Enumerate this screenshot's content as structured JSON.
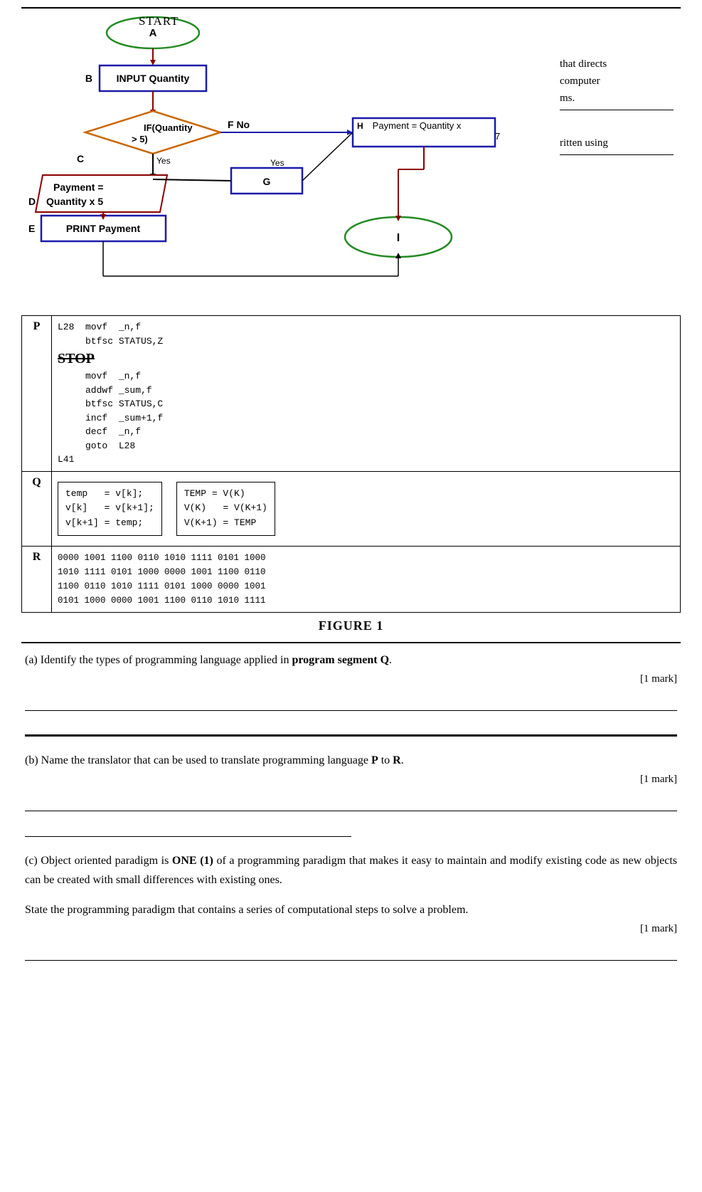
{
  "figure": {
    "title": "FIGURE 1",
    "right_text_line1": "that directs",
    "right_text_line2": "computer",
    "right_text_line3": "ms.",
    "right_text_line4": "ritten using",
    "start_label": "START",
    "flowchart": {
      "node_a_label": "A",
      "node_a_text": "INPUT Quantity",
      "node_b_label": "B",
      "node_if_text": "IF(Quantity > 5)",
      "f_label": "F No",
      "h_label": "H",
      "h_text": "Payment = Quantity x",
      "h_num": "7",
      "yes_label_1": "Yes",
      "yes_label_2": "Yes",
      "c_label": "C",
      "yes_arrow_label": "Yes",
      "g_label": "G",
      "payment_text": "Payment =",
      "quantity_text": "Quantity x 5",
      "print_text": "PRINT Payment",
      "i_label": "I"
    }
  },
  "segments": {
    "p": {
      "label": "P",
      "code_lines": [
        "L28  movf  _n,f",
        "     btfsc STATUS,Z",
        "     movf  _n,f",
        "     addwf _sum,f",
        "     btfsc STATUS,C",
        "     incf  _sum+1,f",
        "     decf  _n,f",
        "     goto  L28",
        "L41"
      ],
      "stop_text": "STOP"
    },
    "q": {
      "label": "Q",
      "box1_lines": [
        "temp   = v[k];",
        "v[k]   = v[k+1];",
        "v[k+1] = temp;"
      ],
      "box2_lines": [
        "TEMP = V(K)",
        "V(K)   = V(K+1)",
        "V(K+1) = TEMP"
      ]
    },
    "r": {
      "label": "R",
      "lines": [
        "0000 1001 1100 0110 1010 1111 0101 1000",
        "1010 1111 0101 1000 0000 1001 1100 0110",
        "1100 0110 1010 1111 0101 1000 0000 1001",
        "0101 1000 0000 1001 1100 0110 1010 1111"
      ]
    }
  },
  "questions": {
    "a": {
      "prefix": "(a)",
      "text": "Identify the types of programming language applied in",
      "bold_part": "program segment Q",
      "suffix": ".",
      "mark": "[1 mark]"
    },
    "b": {
      "prefix": "(b)",
      "text1": "Name the translator that can be used to translate",
      "text2": "programming language",
      "bold_p": "P",
      "to_text": "to",
      "bold_r": "R",
      "suffix": ".",
      "mark": "[1 mark]"
    },
    "c": {
      "prefix": "(c)",
      "para1_text": "Object oriented paradigm is",
      "bold_one": "ONE (1)",
      "para1_rest": "of a programming paradigm that makes it easy to maintain and modify existing code as new objects can be created with small differences with existing ones.",
      "para2": "State the programming paradigm that contains a series of computational steps to solve a problem.",
      "mark": "[1 mark]"
    }
  }
}
